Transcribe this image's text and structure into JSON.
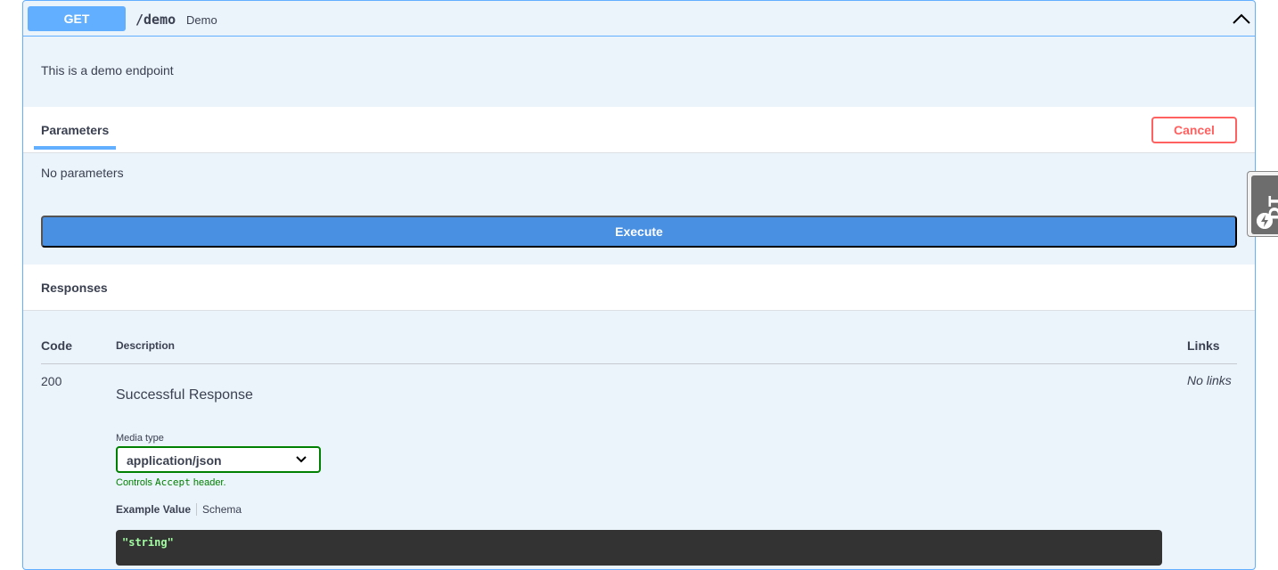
{
  "endpoint": {
    "method": "GET",
    "path": "/demo",
    "summary": "Demo",
    "description": "This is a demo endpoint"
  },
  "parameters": {
    "tab_label": "Parameters",
    "cancel_label": "Cancel",
    "empty_text": "No parameters",
    "execute_label": "Execute"
  },
  "responses": {
    "title": "Responses",
    "headers": {
      "code": "Code",
      "description": "Description",
      "links": "Links"
    },
    "rows": [
      {
        "code": "200",
        "description": "Successful Response",
        "links": "No links",
        "media_type_label": "Media type",
        "media_type_value": "application/json",
        "controls_prefix": "Controls",
        "controls_code": "Accept",
        "controls_suffix": "header.",
        "tab_example": "Example Value",
        "tab_schema": "Schema",
        "example_code": "\"string\""
      }
    ]
  },
  "dev_tools": {
    "label": "DT"
  },
  "colors": {
    "get_accent": "#61affe",
    "execute": "#4990e2",
    "cancel": "#ff6060",
    "success_green": "#008000",
    "code_bg": "#333333",
    "code_text": "#a2fca2"
  },
  "icons": {
    "collapse": "chevron-up-icon",
    "select": "chevron-down-icon",
    "dev_tools": "bolt-icon"
  }
}
